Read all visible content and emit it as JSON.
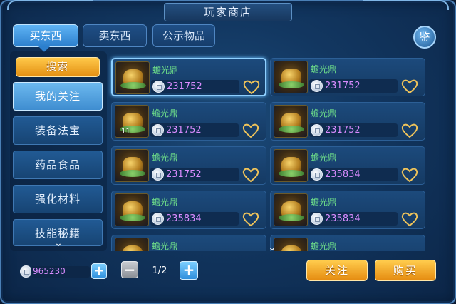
{
  "window": {
    "title": "玩家商店"
  },
  "tabs": [
    {
      "label": "买东西",
      "active": true
    },
    {
      "label": "卖东西",
      "active": false
    },
    {
      "label": "公示物品",
      "active": false
    }
  ],
  "appraise_label": "鉴",
  "sidebar": {
    "search_label": "搜索",
    "categories": [
      {
        "label": "我的关注",
        "selected": true
      },
      {
        "label": "装备法宝",
        "selected": false
      },
      {
        "label": "药品食品",
        "selected": false
      },
      {
        "label": "强化材料",
        "selected": false
      },
      {
        "label": "技能秘籍",
        "selected": false
      }
    ]
  },
  "items": [
    {
      "name": "蟾光鼎",
      "price": "231752",
      "qty": "",
      "selected": true
    },
    {
      "name": "蟾光鼎",
      "price": "231752",
      "qty": "",
      "selected": false
    },
    {
      "name": "蟾光鼎",
      "price": "231752",
      "qty": "11",
      "selected": false
    },
    {
      "name": "蟾光鼎",
      "price": "231752",
      "qty": "",
      "selected": false
    },
    {
      "name": "蟾光鼎",
      "price": "231752",
      "qty": "",
      "selected": false
    },
    {
      "name": "蟾光鼎",
      "price": "235834",
      "qty": "",
      "selected": false
    },
    {
      "name": "蟾光鼎",
      "price": "235834",
      "qty": "",
      "selected": false
    },
    {
      "name": "蟾光鼎",
      "price": "235834",
      "qty": "",
      "selected": false
    },
    {
      "name": "蟾光鼎",
      "price": "",
      "qty": "",
      "selected": false
    },
    {
      "name": "蟾光鼎",
      "price": "",
      "qty": "",
      "selected": false
    }
  ],
  "footer": {
    "money": "965230",
    "page": "1/2",
    "follow_label": "关注",
    "buy_label": "购买"
  },
  "colors": {
    "accent_orange": "#e58b10",
    "price_purple": "#d98cff",
    "name_green": "#6fe08a"
  }
}
